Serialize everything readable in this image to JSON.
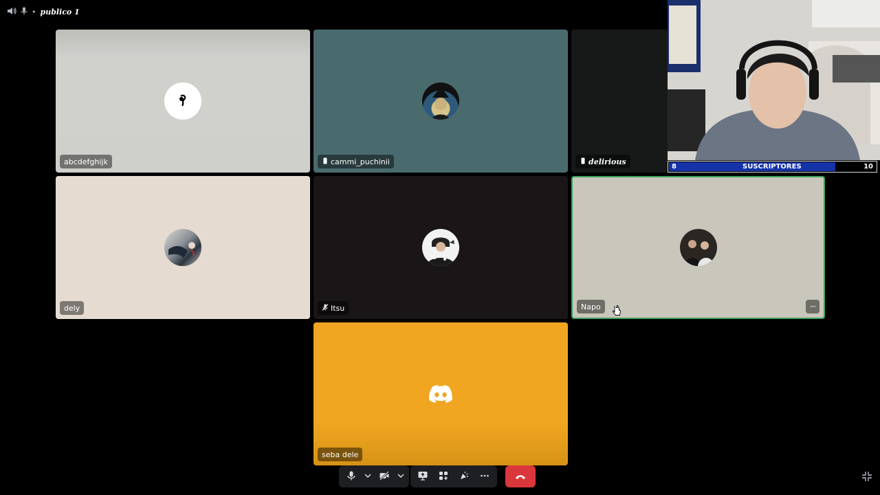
{
  "topbar": {
    "channel_name": "publico 1"
  },
  "tiles": [
    {
      "name": "abcdefghijk",
      "bg": "#cfd0cc"
    },
    {
      "name": "cammi_puchinii",
      "bg": "#4a6b6e"
    },
    {
      "name": "delirious",
      "bg": "#171919"
    },
    {
      "name": "dely",
      "bg": "#e5dbd1"
    },
    {
      "name": "Itsu",
      "bg": "#1a1516"
    },
    {
      "name": "Napo",
      "bg": "#c9c6bb"
    },
    {
      "name": "seba dele",
      "bg": "#f0a620"
    }
  ],
  "subs": {
    "current": "8",
    "label": "SUSCRIPTORES",
    "goal": "10",
    "progress": 0.8,
    "color": "#1533a9"
  },
  "icons": {
    "speaker": "speaker-icon",
    "mic": "microphone-icon",
    "phone": "mobile-device-icon",
    "muted_mic": "muted-mic-icon",
    "discord": "discord-logo-icon",
    "more": "more-options-icon",
    "camera_off": "camera-off-icon",
    "share_screen": "screen-share-icon",
    "activities": "activities-icon",
    "soundboard": "soundboard-icon",
    "hangup": "hang-up-icon",
    "minimize": "minimize-icon",
    "cursor": "pointer-cursor-icon"
  },
  "colors": {
    "speaking_border": "#3ba55d",
    "end_call": "#da373c",
    "control_bg": "#1e1f22"
  }
}
